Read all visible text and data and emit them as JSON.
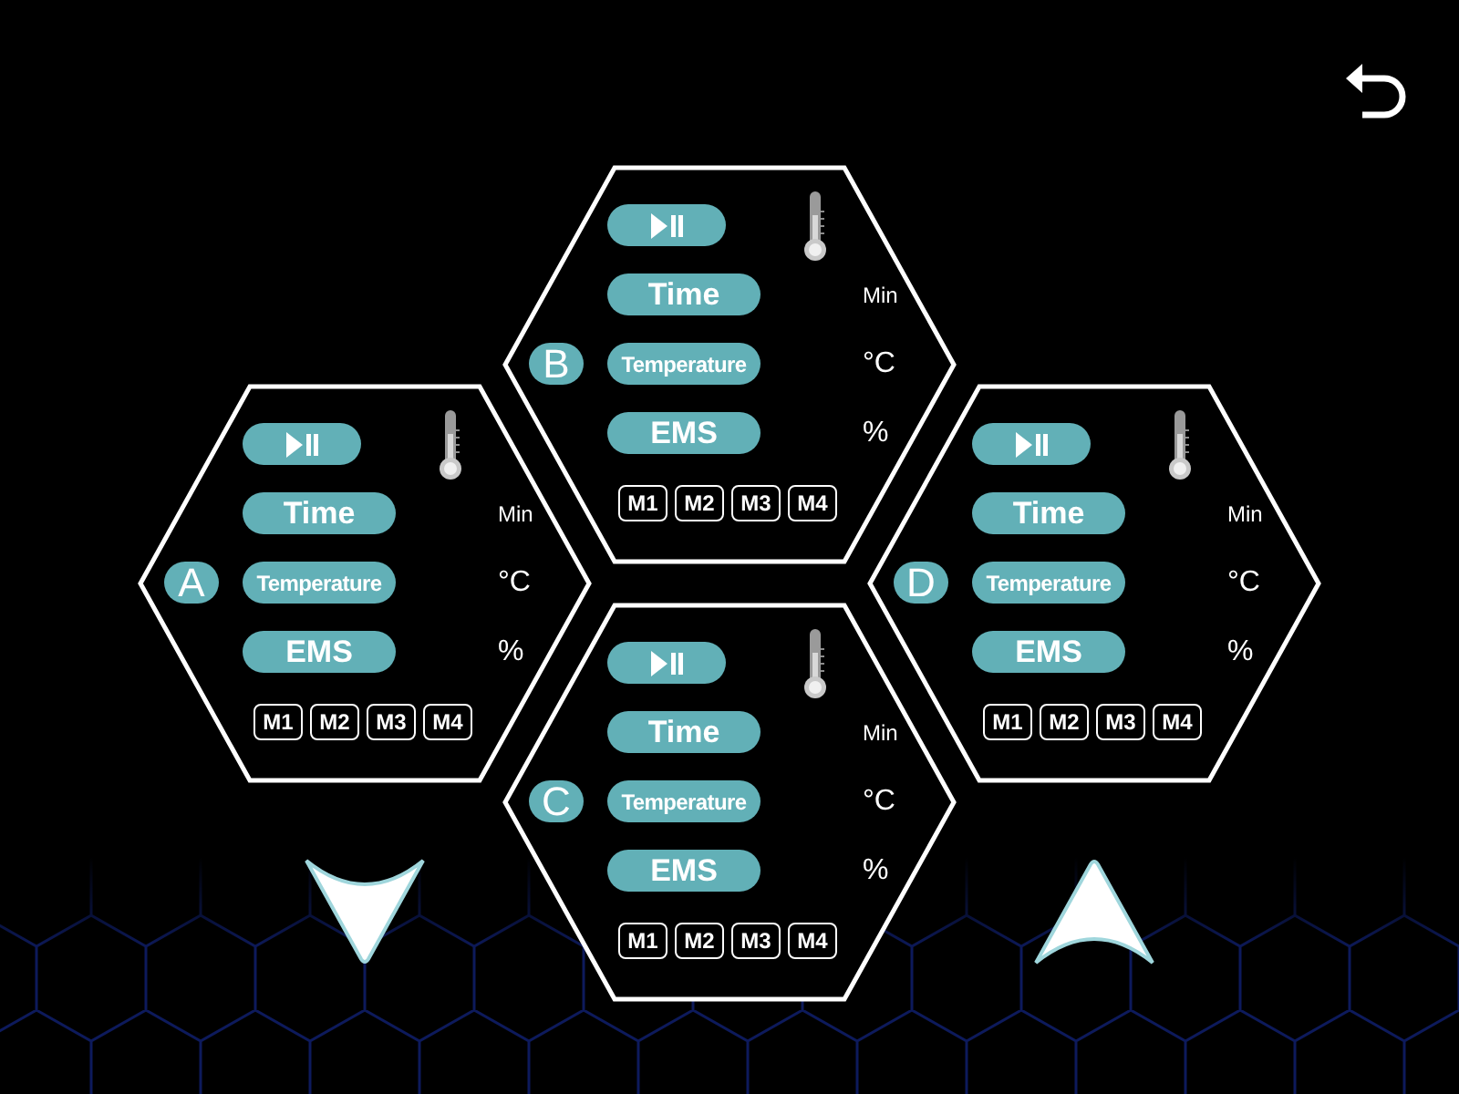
{
  "panels": [
    {
      "letter": "B",
      "rows": [
        {
          "label": "Time",
          "unit": "Min"
        },
        {
          "label": "Temperature",
          "unit": "°C"
        },
        {
          "label": "EMS",
          "unit": "%"
        }
      ],
      "modes": [
        "M1",
        "M2",
        "M3",
        "M4"
      ]
    },
    {
      "letter": "A",
      "rows": [
        {
          "label": "Time",
          "unit": "Min"
        },
        {
          "label": "Temperature",
          "unit": "°C"
        },
        {
          "label": "EMS",
          "unit": "%"
        }
      ],
      "modes": [
        "M1",
        "M2",
        "M3",
        "M4"
      ]
    },
    {
      "letter": "D",
      "rows": [
        {
          "label": "Time",
          "unit": "Min"
        },
        {
          "label": "Temperature",
          "unit": "°C"
        },
        {
          "label": "EMS",
          "unit": "%"
        }
      ],
      "modes": [
        "M1",
        "M2",
        "M3",
        "M4"
      ]
    },
    {
      "letter": "C",
      "rows": [
        {
          "label": "Time",
          "unit": "Min"
        },
        {
          "label": "Temperature",
          "unit": "°C"
        },
        {
          "label": "EMS",
          "unit": "%"
        }
      ],
      "modes": [
        "M1",
        "M2",
        "M3",
        "M4"
      ]
    }
  ]
}
